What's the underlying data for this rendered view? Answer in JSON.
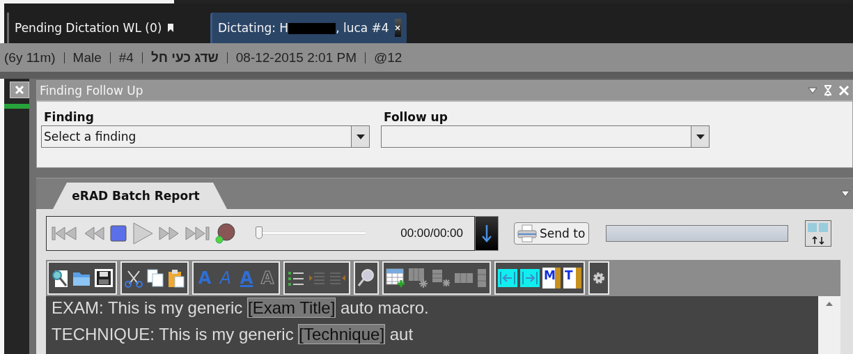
{
  "tabs": [
    {
      "kind": "plain",
      "label": "Pending Dictation WL (0)",
      "selected": false
    },
    {
      "kind": "redacted",
      "label_start": "Dictating: H",
      "label_end": ", luca #4",
      "selected": true
    }
  ],
  "patient_bar": [
    {
      "text": "(6y 11m)",
      "bold": false
    },
    {
      "text": "Male",
      "bold": false
    },
    {
      "text": "#4",
      "bold": false
    },
    {
      "text": "שדג כעי חל",
      "bold": true
    },
    {
      "text": "08-12-2015 2:01 PM",
      "bold": false
    },
    {
      "text": "@12",
      "bold": false
    }
  ],
  "finding_panel": {
    "title": "Finding Follow Up",
    "fields": [
      {
        "label": "Finding",
        "value": "Select a finding"
      },
      {
        "label": "Follow up"
      }
    ]
  },
  "report": {
    "tab": "eRAD Batch Report",
    "player": {
      "buttons": [
        {
          "kind": "first"
        },
        {
          "kind": "rewind"
        },
        {
          "kind": "stop"
        },
        {
          "kind": "play"
        },
        {
          "kind": "forward"
        },
        {
          "kind": "last"
        },
        {
          "kind": "record"
        }
      ],
      "level": 0,
      "time": "00:00/00:00"
    },
    "send_button": "Send to",
    "progress": {
      "level": 0
    },
    "toolbar": [
      [
        {
          "kind": "preview"
        },
        {
          "kind": "folder"
        },
        {
          "kind": "save"
        }
      ],
      [
        {
          "kind": "cut"
        },
        {
          "kind": "copy"
        },
        {
          "kind": "paste"
        }
      ],
      [
        {
          "kind": "letter",
          "glyph": "A",
          "disabled": false
        },
        {
          "kind": "italic",
          "glyph": "A",
          "disabled": false
        },
        {
          "kind": "underline",
          "glyph": "A",
          "disabled": false
        },
        {
          "kind": "outline",
          "glyph": "A",
          "disabled": true
        }
      ],
      [
        {
          "kind": "bullets",
          "disabled": false
        },
        {
          "kind": "indent",
          "disabled": true
        },
        {
          "kind": "outdent",
          "disabled": true
        }
      ],
      [
        {
          "kind": "find"
        }
      ],
      [
        {
          "kind": "table"
        },
        {
          "kind": "column-star",
          "disabled": true
        },
        {
          "kind": "row-star",
          "disabled": true
        },
        {
          "kind": "columns",
          "disabled": true
        },
        {
          "kind": "rows",
          "disabled": true
        }
      ],
      [
        {
          "kind": "prev"
        },
        {
          "kind": "next"
        },
        {
          "kind": "doc",
          "glyph": "M"
        },
        {
          "kind": "doc",
          "glyph": "T"
        }
      ],
      [
        {
          "kind": "gear"
        }
      ]
    ],
    "editor": [
      [
        {
          "text": "EXAM: This is my generic "
        },
        {
          "text": "[Exam Title]",
          "kind": "field"
        },
        {
          "text": " auto macro."
        }
      ],
      [
        {
          "text": "TECHNIQUE: This is my generic "
        },
        {
          "text": "[Technique]",
          "kind": "field"
        },
        {
          "text": " aut"
        }
      ]
    ]
  }
}
